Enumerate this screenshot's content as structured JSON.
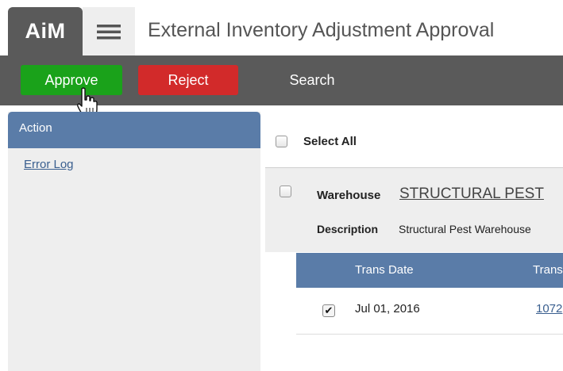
{
  "header": {
    "logo": "AiM",
    "title": "External Inventory Adjustment Approval",
    "menu_icon": "hamburger-menu-icon"
  },
  "toolbar": {
    "approve_label": "Approve",
    "reject_label": "Reject",
    "search_label": "Search",
    "approve_color": "#1aa21a",
    "reject_color": "#d22a2a"
  },
  "left_panel": {
    "header": "Action",
    "links": [
      "Error Log"
    ]
  },
  "main": {
    "select_all_label": "Select All",
    "select_all_checked": false,
    "warehouse": {
      "label": "Warehouse",
      "value": "STRUCTURAL PEST",
      "description_label": "Description",
      "description_value": "Structural Pest Warehouse",
      "checked": false
    },
    "transactions": {
      "columns": [
        "Trans Date",
        "Trans"
      ],
      "rows": [
        {
          "checked": true,
          "date": "Jul 01, 2016",
          "number": "1072"
        }
      ]
    }
  },
  "colors": {
    "accent_blue": "#5a7ca8",
    "toolbar_gray": "#5a5a5a"
  }
}
